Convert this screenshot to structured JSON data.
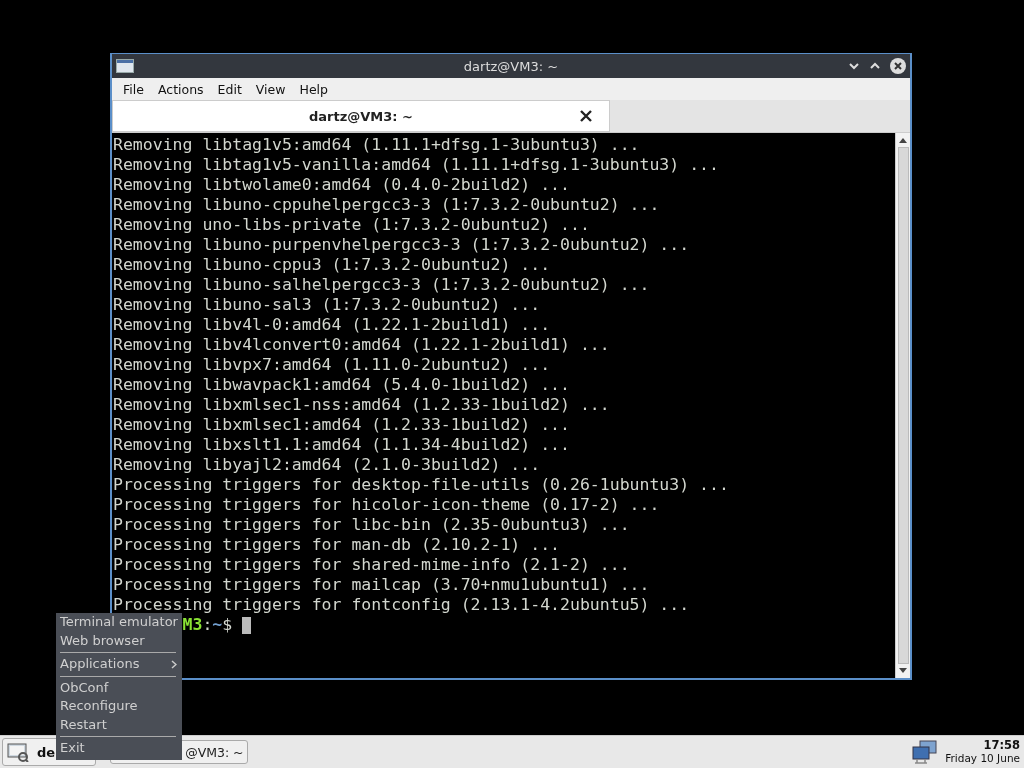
{
  "window": {
    "title": "dartz@VM3: ~"
  },
  "menu_bar": [
    "File",
    "Actions",
    "Edit",
    "View",
    "Help"
  ],
  "tabs": [
    {
      "label": "dartz@VM3: ~",
      "selected": true
    }
  ],
  "terminal": {
    "lines": [
      "Removing libtag1v5:amd64 (1.11.1+dfsg.1-3ubuntu3) ...",
      "Removing libtag1v5-vanilla:amd64 (1.11.1+dfsg.1-3ubuntu3) ...",
      "Removing libtwolame0:amd64 (0.4.0-2build2) ...",
      "Removing libuno-cppuhelpergcc3-3 (1:7.3.2-0ubuntu2) ...",
      "Removing uno-libs-private (1:7.3.2-0ubuntu2) ...",
      "Removing libuno-purpenvhelpergcc3-3 (1:7.3.2-0ubuntu2) ...",
      "Removing libuno-cppu3 (1:7.3.2-0ubuntu2) ...",
      "Removing libuno-salhelpergcc3-3 (1:7.3.2-0ubuntu2) ...",
      "Removing libuno-sal3 (1:7.3.2-0ubuntu2) ...",
      "Removing libv4l-0:amd64 (1.22.1-2build1) ...",
      "Removing libv4lconvert0:amd64 (1.22.1-2build1) ...",
      "Removing libvpx7:amd64 (1.11.0-2ubuntu2) ...",
      "Removing libwavpack1:amd64 (5.4.0-1build2) ...",
      "Removing libxmlsec1-nss:amd64 (1.2.33-1build2) ...",
      "Removing libxmlsec1:amd64 (1.2.33-1build2) ...",
      "Removing libxslt1.1:amd64 (1.1.34-4build2) ...",
      "Removing libyajl2:amd64 (2.1.0-3build2) ...",
      "Processing triggers for desktop-file-utils (0.26-1ubuntu3) ...",
      "Processing triggers for hicolor-icon-theme (0.17-2) ...",
      "Processing triggers for libc-bin (2.35-0ubuntu3) ...",
      "Processing triggers for man-db (2.10.2-1) ...",
      "Processing triggers for shared-mime-info (2.1-2) ...",
      "Processing triggers for mailcap (3.70+nmu1ubuntu1) ...",
      "Processing triggers for fontconfig (2.13.1-4.2ubuntu5) ..."
    ],
    "prompt": {
      "host": "M3",
      "separator": ":",
      "path": "~",
      "symbol": "$"
    }
  },
  "context_menu": {
    "items": [
      {
        "kind": "item",
        "label": "Terminal emulator"
      },
      {
        "kind": "item",
        "label": "Web browser"
      },
      {
        "kind": "separator"
      },
      {
        "kind": "submenu",
        "label": "Applications"
      },
      {
        "kind": "separator"
      },
      {
        "kind": "item",
        "label": "ObConf"
      },
      {
        "kind": "item",
        "label": "Reconfigure"
      },
      {
        "kind": "item",
        "label": "Restart"
      },
      {
        "kind": "separator"
      },
      {
        "kind": "item",
        "label": "Exit"
      }
    ]
  },
  "taskbar": {
    "start_label": "de",
    "tasks": [
      {
        "label": "@VM3: ~"
      }
    ],
    "clock": {
      "time": "17:58",
      "date": "Friday 10 June"
    }
  }
}
